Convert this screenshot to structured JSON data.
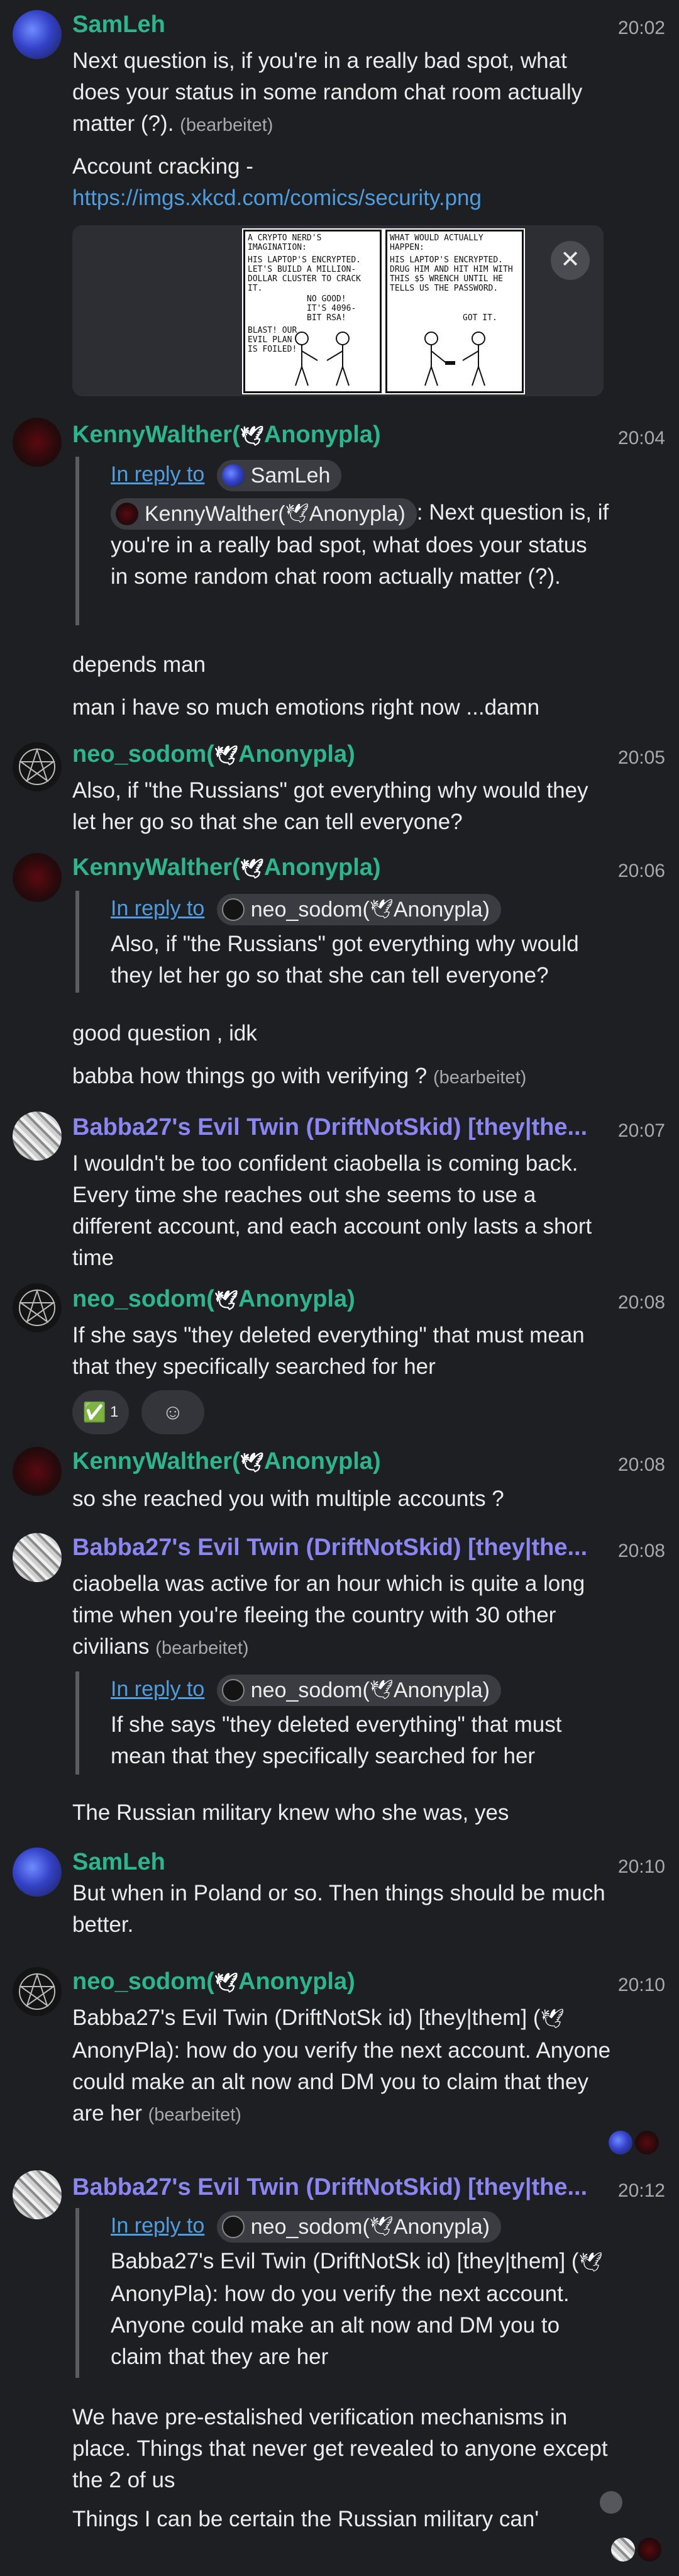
{
  "messages": {
    "m1": {
      "sender": "SamLeh",
      "time": "20:02",
      "text": "Next question is, if you're in a really bad spot, what does your status in some random chat room actually matter (?).",
      "edited": "(bearbeitet)",
      "link_prefix": "Account cracking - ",
      "link": "https://imgs.xkcd.com/comics/security.png",
      "comic": {
        "panel1_text": "A CRYPTO NERD'S IMAGINATION:",
        "panel1_body": "HIS LAPTOP'S ENCRYPTED. LET'S BUILD A MILLION-DOLLAR CLUSTER TO CRACK IT.",
        "panel1_reply": "NO GOOD! IT'S 4096-BIT RSA!",
        "panel1_foot": "BLAST! OUR EVIL PLAN IS FOILED!",
        "panel2_text": "WHAT WOULD ACTUALLY HAPPEN:",
        "panel2_body": "HIS LAPTOP'S ENCRYPTED. DRUG HIM AND HIT HIM WITH THIS $5 WRENCH UNTIL HE TELLS US THE PASSWORD.",
        "panel2_reply": "GOT IT."
      },
      "close_glyph": "✕"
    },
    "m2": {
      "sender": "KennyWalther(",
      "sender_dove": "🕊",
      "sender_tail": "Anonypla)",
      "time": "20:04",
      "reply_label": "In reply to",
      "reply_to": "SamLeh",
      "quote_author": "KennyWalther(",
      "quote_dove": "🕊",
      "quote_author_tail": "Anonypla)",
      "quote_text": ": Next question is, if you're in a really bad spot, what does your status in some random chat room actually matter (?).",
      "line1": "depends man",
      "line2": "man i have so much emotions right now ...damn"
    },
    "m3": {
      "sender": "neo_sodom(",
      "sender_dove": "🕊",
      "sender_tail": "Anonypla)",
      "time": "20:05",
      "text": "Also, if \"the Russians\" got everything why would they let her go so that she can tell everyone?"
    },
    "m4": {
      "sender": "KennyWalther(",
      "sender_dove": "🕊",
      "sender_tail": "Anonypla)",
      "time": "20:06",
      "reply_label": "In reply to",
      "reply_to": "neo_sodom(",
      "reply_dove": "🕊",
      "reply_to_tail": "Anonypla)",
      "quote_text": "Also, if \"the Russians\" got everything why would they let her go so that she can tell everyone?",
      "line1": "good question , idk",
      "line2": "babba how things go with verifying ?",
      "edited": "(bearbeitet)"
    },
    "m5": {
      "sender": "Babba27's Evil Twin (DriftNotSkid) [they|the...",
      "time": "20:07",
      "text": "I wouldn't be too confident ciaobella is coming back. Every time she reaches out she seems to use a different account, and each account only lasts a short time"
    },
    "m6": {
      "sender": "neo_sodom(",
      "sender_dove": "🕊",
      "sender_tail": "Anonypla)",
      "time": "20:08",
      "text": "If she says \"they deleted everything\" that must mean that they specifically searched for her",
      "reaction_emoji": "✅",
      "reaction_count": "1",
      "add_reaction_icon": "☺"
    },
    "m7": {
      "sender": "KennyWalther(",
      "sender_dove": "🕊",
      "sender_tail": "Anonypla)",
      "time": "20:08",
      "text": "so she reached you with multiple accounts ?"
    },
    "m8": {
      "sender": "Babba27's Evil Twin (DriftNotSkid) [they|the...",
      "time": "20:08",
      "text": "ciaobella was active for an hour which is quite a long time when you're fleeing the country with 30 other civilians",
      "edited": "(bearbeitet)",
      "reply_label": "In reply to",
      "reply_to": "neo_sodom(",
      "reply_dove": "🕊",
      "reply_to_tail": "Anonypla)",
      "quote_text": "If she says \"they deleted everything\" that must mean that they specifically searched for her",
      "line1": "The Russian military knew who she was, yes"
    },
    "m9": {
      "sender": "SamLeh",
      "time": "20:10",
      "text": "But when in Poland or so. Then things should be much better."
    },
    "m10": {
      "sender": "neo_sodom(",
      "sender_dove": "🕊",
      "sender_tail": "Anonypla)",
      "time": "20:10",
      "text_a": "Babba27's Evil Twin (DriftNotSk id) [they|them] (",
      "text_dove": "🕊",
      "text_b": "AnonyPla):  how do you verify the next account. Anyone could make an alt now and DM you to claim that they are her",
      "edited": "(bearbeitet)"
    },
    "m11": {
      "sender": "Babba27's Evil Twin (DriftNotSkid) [they|the...",
      "time": "20:12",
      "reply_label": "In reply to",
      "reply_to": "neo_sodom(",
      "reply_dove": "🕊",
      "reply_to_tail": "Anonypla)",
      "quote_a": "Babba27's Evil Twin (DriftNotSk id) [they|them] (",
      "quote_dove": "🕊",
      "quote_b": "AnonyPla): how do you verify the next account. Anyone could make an alt now and DM you to claim that they are her",
      "line1": "We have pre-estalished verification mechanisms in place. Things that never get revealed to anyone except the 2 of us",
      "line2": "Things I can be certain the Russian military can'"
    }
  },
  "colors": {
    "background": "#1d1f23",
    "sender_green": "#2fb58e",
    "sender_purple": "#8c86f2",
    "link": "#4f9ddf"
  }
}
